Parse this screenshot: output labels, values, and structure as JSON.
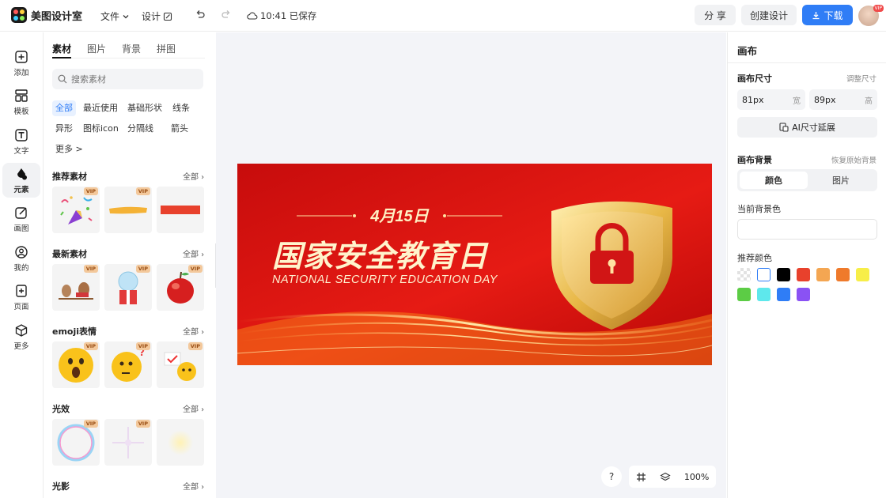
{
  "header": {
    "app_name": "美图设计室",
    "menu_file": "文件",
    "menu_design": "设计",
    "save_status": "10:41 已保存",
    "share_label": "分 享",
    "create_label": "创建设计",
    "download_label": "下载",
    "vip_badge": "VIP"
  },
  "rail": {
    "items": [
      {
        "label": "添加",
        "icon": "plus-square-icon"
      },
      {
        "label": "模板",
        "icon": "template-icon"
      },
      {
        "label": "文字",
        "icon": "text-icon"
      },
      {
        "label": "元素",
        "icon": "elements-icon"
      },
      {
        "label": "画图",
        "icon": "draw-icon"
      },
      {
        "label": "我的",
        "icon": "user-icon"
      },
      {
        "label": "页面",
        "icon": "page-add-icon"
      },
      {
        "label": "更多",
        "icon": "cube-icon"
      }
    ]
  },
  "panel": {
    "tabs": [
      "素材",
      "图片",
      "背景",
      "拼图"
    ],
    "search_placeholder": "搜索素材",
    "chips": [
      "全部",
      "最近使用",
      "基础形状",
      "线条",
      "异形",
      "图标icon",
      "分隔线",
      "箭头",
      "更多 >"
    ],
    "vip_label": "VIP",
    "all_label": "全部",
    "sections": [
      {
        "title": "推荐素材"
      },
      {
        "title": "最新素材"
      },
      {
        "title": "emoji表情"
      },
      {
        "title": "光效"
      },
      {
        "title": "光影"
      }
    ]
  },
  "canvas": {
    "date": "4月15日",
    "title": "国家安全教育日",
    "subtitle": "NATIONAL SECURITY EDUCATION DAY",
    "zoom": "100%",
    "help": "?"
  },
  "right_panel": {
    "title": "画布",
    "size_label": "画布尺寸",
    "resize_link": "调整尺寸",
    "width_value": "81px",
    "width_unit": "宽",
    "height_value": "89px",
    "height_unit": "高",
    "ai_extend": "AI尺寸延展",
    "bg_label": "画布背景",
    "restore_link": "恢复原始背景",
    "seg_color": "颜色",
    "seg_image": "图片",
    "current_color_label": "当前背景色",
    "recommended_label": "推荐颜色",
    "swatches": [
      "transparent",
      "#ffffff",
      "#000000",
      "#e8412c",
      "#f4a652",
      "#ef7a2b",
      "#f7ee48",
      "#5ccc45",
      "#5ee8ec",
      "#2f7df6",
      "#8a52f4"
    ]
  }
}
